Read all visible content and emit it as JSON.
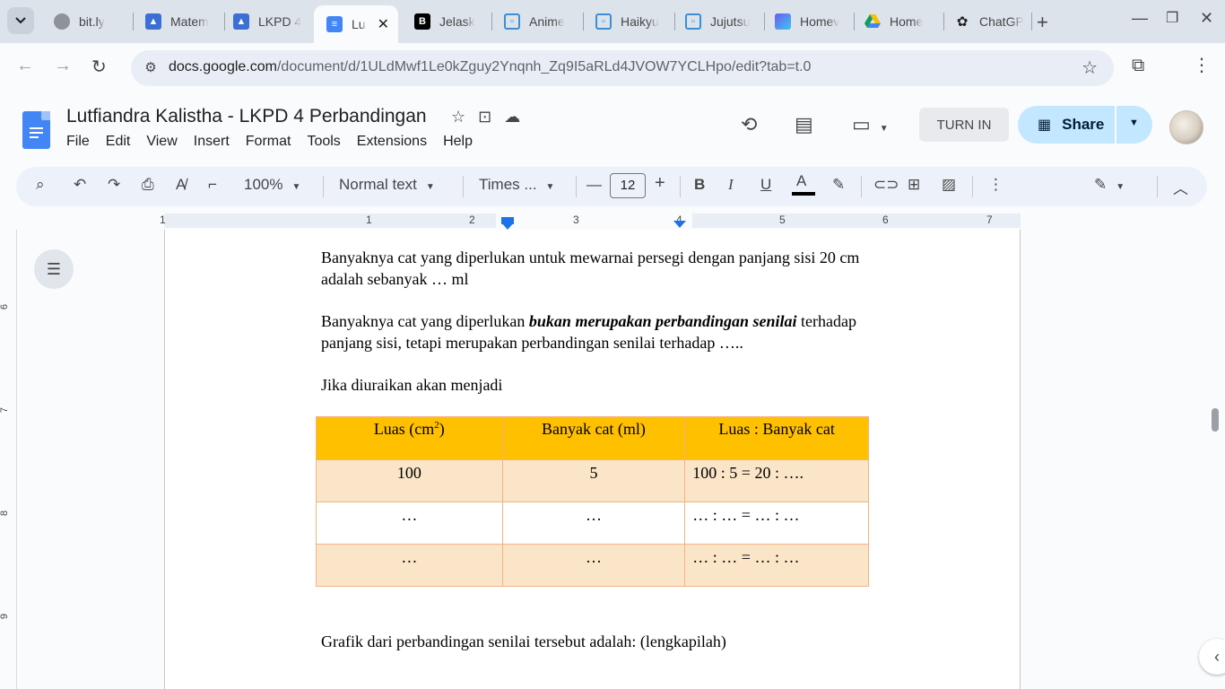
{
  "browser": {
    "tabs": [
      {
        "title": "bit.ly",
        "icon": "globe-icon"
      },
      {
        "title": "Matem",
        "icon": "google-classroom-icon"
      },
      {
        "title": "LKPD 4",
        "icon": "google-classroom-icon"
      },
      {
        "title": "Lu",
        "icon": "google-docs-icon",
        "active": true
      },
      {
        "title": "Jelask",
        "icon": "brainly-icon"
      },
      {
        "title": "Anime",
        "icon": "bot-icon"
      },
      {
        "title": "Haikyu",
        "icon": "bot-icon"
      },
      {
        "title": "Jujutsu",
        "icon": "bot-icon"
      },
      {
        "title": "Homev",
        "icon": "hex-icon"
      },
      {
        "title": "Home",
        "icon": "google-drive-icon"
      },
      {
        "title": "ChatGP",
        "icon": "chatgpt-icon"
      }
    ],
    "url_host": "docs.google.com",
    "url_path": "/document/d/1ULdMwf1Le0kZguy2Ynqnh_Zq9I5aRLd4JVOW7YCLHpo/edit?tab=t.0"
  },
  "docs": {
    "title": "Lutfiandra Kalistha - LKPD 4 Perbandingan",
    "menu": [
      "File",
      "Edit",
      "View",
      "Insert",
      "Format",
      "Tools",
      "Extensions",
      "Help"
    ],
    "turn_in": "TURN IN",
    "share": "Share"
  },
  "toolbar": {
    "zoom": "100%",
    "style": "Normal text",
    "font": "Times ...",
    "font_size": "12"
  },
  "ruler": {
    "h_numbers": [
      "1",
      "1",
      "2",
      "3",
      "4",
      "5",
      "6",
      "7"
    ],
    "v_numbers": [
      "6",
      "7",
      "8",
      "9"
    ]
  },
  "document": {
    "p1_line1": "Banyaknya cat yang diperlukan untuk mewarnai persegi dengan panjang sisi 20 cm",
    "p1_line2": "adalah sebanyak …   ml",
    "p2_prefix": "Banyaknya cat yang diperlukan ",
    "p2_emphasis": "bukan merupakan perbandingan senilai",
    "p2_suffix": " terhadap",
    "p2_line2": "panjang sisi, tetapi merupakan perbandingan senilai terhadap …..",
    "p3": "Jika diuraikan akan menjadi",
    "table": {
      "h1_text": "Luas (cm",
      "h1_sup": "2",
      "h1_close": ")",
      "h2": "Banyak cat (ml)",
      "h3": "Luas : Banyak cat",
      "rows": [
        [
          "100",
          "5",
          "100 : 5   = 20  : …."
        ],
        [
          "…",
          "…",
          "…  :  … =  … :  …"
        ],
        [
          "…",
          "…",
          "…  :  … =  … :  …"
        ]
      ]
    },
    "p4": "Grafik dari perbandingan senilai tersebut adalah: (lengkapilah)"
  }
}
